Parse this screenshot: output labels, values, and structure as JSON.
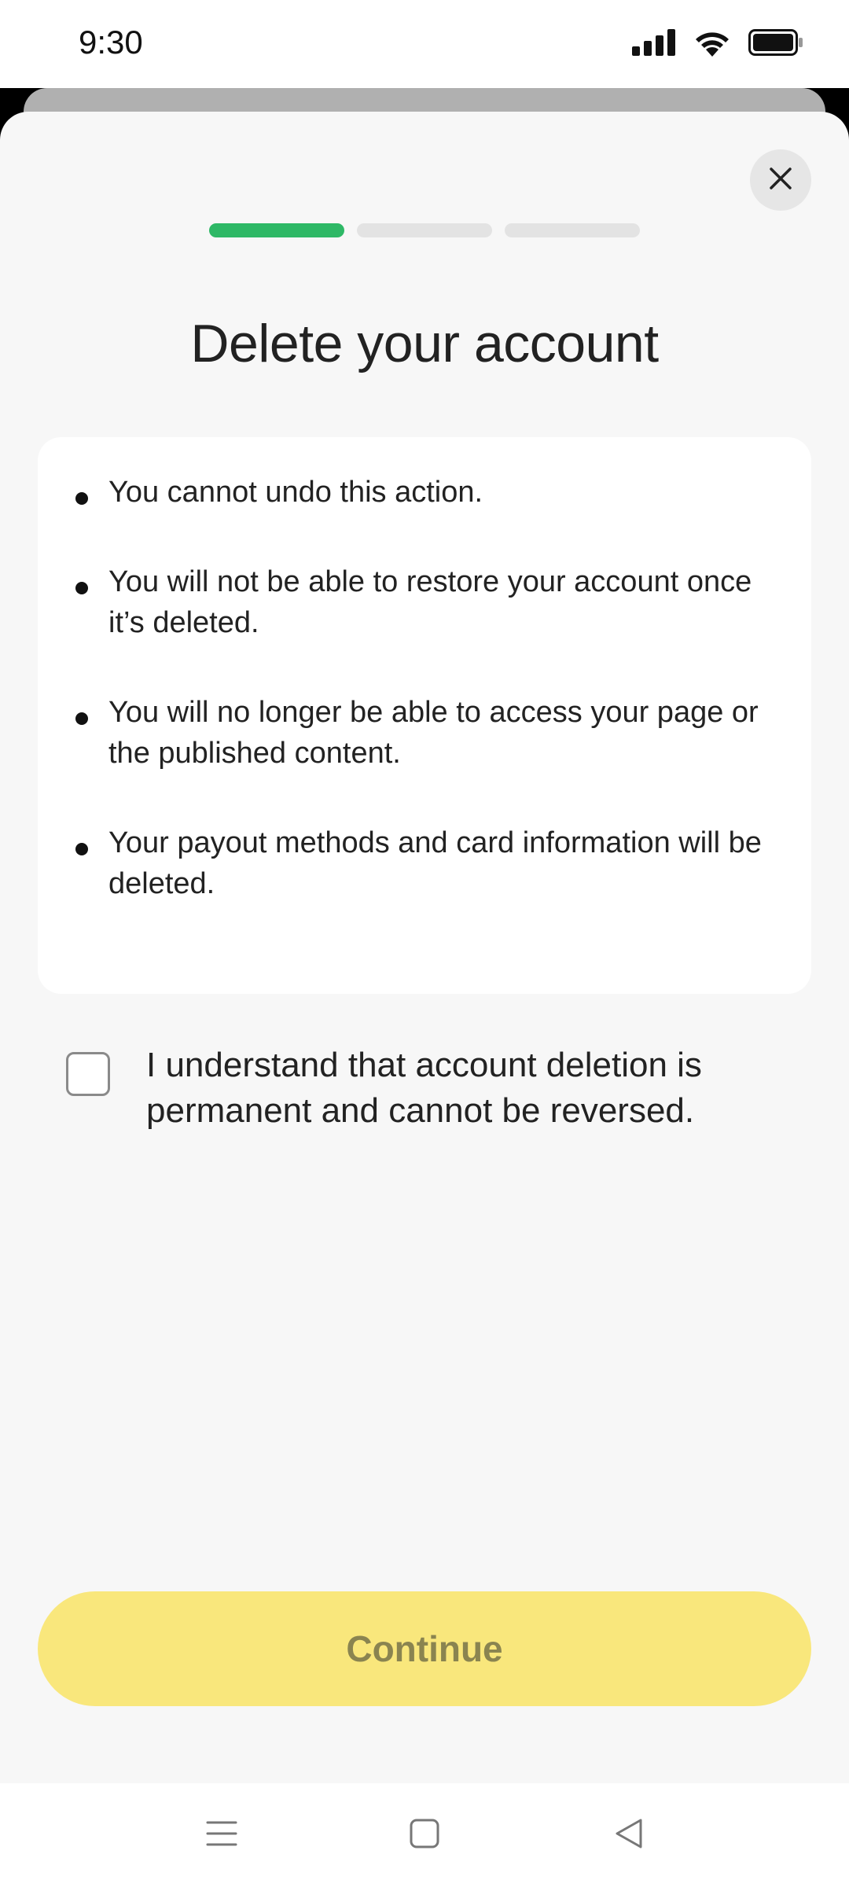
{
  "status_bar": {
    "time": "9:30",
    "icons": [
      "signal-icon",
      "wifi-icon",
      "battery-icon"
    ]
  },
  "sheet": {
    "close_icon": "close-icon",
    "progress": {
      "total_steps": 3,
      "current_step": 1,
      "active_color": "#2eb866",
      "inactive_color": "#e3e3e3"
    },
    "title": "Delete your account",
    "warnings": [
      "You cannot undo this action.",
      "You will not be able to restore your account once it’s deleted.",
      "You will no longer be able to access your page or the published content.",
      "Your payout methods and card information will be deleted."
    ],
    "confirm": {
      "checked": false,
      "label": "I understand that account deletion is permanent and cannot be reversed."
    },
    "continue_label": "Continue",
    "continue_color": "#f9e77c"
  },
  "nav_bar": {
    "icons": [
      "menu-icon",
      "home-icon",
      "back-icon"
    ]
  }
}
